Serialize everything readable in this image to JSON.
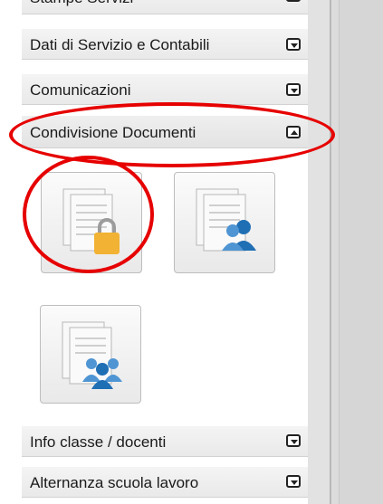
{
  "menu": {
    "top_partial_label": "Stampe Servizi",
    "items": [
      {
        "label": "Dati di Servizio e Contabili",
        "state": "collapsed"
      },
      {
        "label": "Comunicazioni",
        "state": "collapsed"
      },
      {
        "label": "Condivisione Documenti",
        "state": "expanded"
      },
      {
        "label": "Info classe / docenti",
        "state": "collapsed"
      },
      {
        "label": "Alternanza scuola lavoro",
        "state": "collapsed"
      }
    ]
  },
  "tiles": [
    {
      "icon": "document-lock-icon"
    },
    {
      "icon": "document-user-icon"
    },
    {
      "icon": "document-group-icon"
    }
  ],
  "colors": {
    "highlight": "#e60000",
    "lock": "#f2b233",
    "users": "#1f6fb5"
  }
}
